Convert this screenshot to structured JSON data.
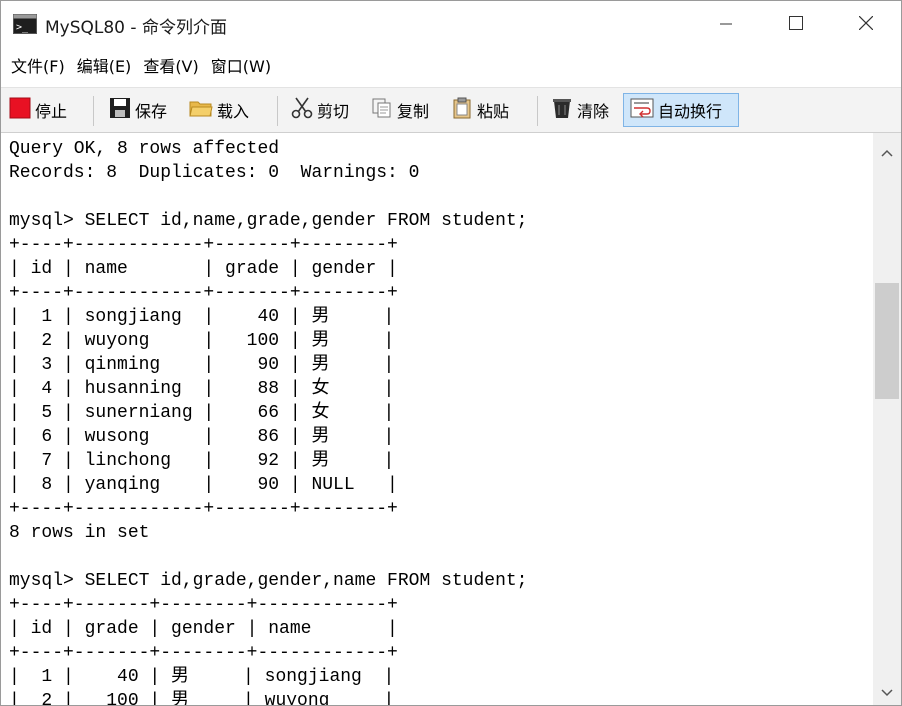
{
  "window": {
    "title": "MySQL80 - 命令列介面"
  },
  "menu": {
    "items": [
      {
        "label": "文件(F)"
      },
      {
        "label": "编辑(E)"
      },
      {
        "label": "查看(V)"
      },
      {
        "label": "窗口(W)"
      }
    ]
  },
  "toolbar": {
    "stop_label": "停止",
    "save_label": "保存",
    "load_label": "载入",
    "cut_label": "剪切",
    "copy_label": "复制",
    "paste_label": "粘贴",
    "clear_label": "清除",
    "wrap_label": "自动换行",
    "wrap_active": true
  },
  "colors": {
    "stop_red": "#e81123",
    "wrap_active_bg": "#cfe6fa",
    "wrap_active_border": "#7fb4e6",
    "folder_yellow": "#e8b84a"
  },
  "console": {
    "lines": [
      "Query OK, 8 rows affected",
      "Records: 8  Duplicates: 0  Warnings: 0",
      "",
      "mysql> SELECT id,name,grade,gender FROM student;",
      "+----+------------+-------+--------+",
      "| id | name       | grade | gender |",
      "+----+------------+-------+--------+",
      "|  1 | songjiang  |    40 | 男     |",
      "|  2 | wuyong     |   100 | 男     |",
      "|  3 | qinming    |    90 | 男     |",
      "|  4 | husanning  |    88 | 女     |",
      "|  5 | sunerniang |    66 | 女     |",
      "|  6 | wusong     |    86 | 男     |",
      "|  7 | linchong   |    92 | 男     |",
      "|  8 | yanqing    |    90 | NULL   |",
      "+----+------------+-------+--------+",
      "8 rows in set",
      "",
      "mysql> SELECT id,grade,gender,name FROM student;",
      "+----+-------+--------+------------+",
      "| id | grade | gender | name       |",
      "+----+-------+--------+------------+",
      "|  1 |    40 | 男     | songjiang  |",
      "|  2 |   100 | 男     | wuyong     |"
    ]
  },
  "scrollbar": {
    "position": 0.27
  }
}
